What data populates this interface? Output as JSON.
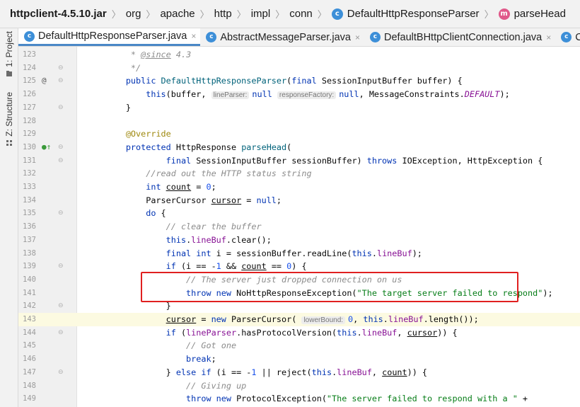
{
  "breadcrumb": {
    "items": [
      {
        "label": "httpclient-4.5.10.jar",
        "icon": "",
        "bold": true
      },
      {
        "label": "org",
        "icon": ""
      },
      {
        "label": "apache",
        "icon": ""
      },
      {
        "label": "http",
        "icon": ""
      },
      {
        "label": "impl",
        "icon": ""
      },
      {
        "label": "conn",
        "icon": ""
      },
      {
        "label": "DefaultHttpResponseParser",
        "icon": "class"
      },
      {
        "label": "parseHead",
        "icon": "method"
      }
    ],
    "class_glyph": "c",
    "method_glyph": "m"
  },
  "toolstrip": {
    "project_label": "1: Project",
    "structure_label": "Z: Structure"
  },
  "tabs": [
    {
      "label": "DefaultHttpResponseParser.java",
      "active": true,
      "close": "×"
    },
    {
      "label": "AbstractMessageParser.java",
      "active": false,
      "close": "×"
    },
    {
      "label": "DefaultBHttpClientConnection.java",
      "active": false,
      "close": "×"
    },
    {
      "label": "CPo",
      "active": false,
      "close": ""
    }
  ],
  "editor": {
    "highlight_color": "#e02020",
    "lines": [
      {
        "num": "123",
        "fold": "",
        "gutter": "",
        "tokens": [
          [
            "cmt",
            "         * "
          ],
          [
            "cmt doctag",
            "@since"
          ],
          [
            "cmt",
            " 4.3"
          ]
        ]
      },
      {
        "num": "124",
        "fold": "⊖",
        "gutter": "",
        "tokens": [
          [
            "cmt",
            "         */"
          ]
        ]
      },
      {
        "num": "125",
        "fold": "⊖",
        "gutter": "@",
        "tokens": [
          [
            "",
            "        "
          ],
          [
            "kw",
            "public "
          ],
          [
            "fn",
            "DefaultHttpResponseParser"
          ],
          [
            "",
            "("
          ],
          [
            "kw",
            "final "
          ],
          [
            "",
            "SessionInputBuffer buffer) {"
          ]
        ]
      },
      {
        "num": "126",
        "fold": "",
        "gutter": "",
        "tokens": [
          [
            "",
            "            "
          ],
          [
            "kw",
            "this"
          ],
          [
            "",
            "(buffer, "
          ],
          [
            "hint",
            "lineParser:"
          ],
          [
            "kw",
            "null"
          ],
          [
            ",",
            " "
          ],
          [
            "hint",
            "responseFactory:"
          ],
          [
            "kw",
            "null"
          ],
          [
            "",
            ", MessageConstraints."
          ],
          [
            "ital",
            "DEFAULT"
          ],
          [
            "",
            ");"
          ]
        ]
      },
      {
        "num": "127",
        "fold": "⊖",
        "gutter": "",
        "tokens": [
          [
            "",
            "        }"
          ]
        ]
      },
      {
        "num": "128",
        "fold": "",
        "gutter": "",
        "tokens": [
          [
            "",
            ""
          ]
        ]
      },
      {
        "num": "129",
        "fold": "",
        "gutter": "",
        "tokens": [
          [
            "",
            "        "
          ],
          [
            "ann",
            "@Override"
          ]
        ]
      },
      {
        "num": "130",
        "fold": "⊖",
        "gutter": "●↑",
        "gutter_class": "ov",
        "tokens": [
          [
            "",
            "        "
          ],
          [
            "kw",
            "protected "
          ],
          [
            "",
            "HttpResponse "
          ],
          [
            "fn",
            "parseHead"
          ],
          [
            "",
            "("
          ]
        ]
      },
      {
        "num": "131",
        "fold": "⊖",
        "gutter": "",
        "tokens": [
          [
            "",
            "                "
          ],
          [
            "kw",
            "final "
          ],
          [
            "",
            "SessionInputBuffer sessionBuffer) "
          ],
          [
            "kw",
            "throws "
          ],
          [
            "",
            "IOException, HttpException {"
          ]
        ]
      },
      {
        "num": "132",
        "fold": "",
        "gutter": "",
        "tokens": [
          [
            "",
            "            "
          ],
          [
            "cmt",
            "//read out the HTTP status string"
          ]
        ]
      },
      {
        "num": "133",
        "fold": "",
        "gutter": "",
        "tokens": [
          [
            "",
            "            "
          ],
          [
            "kw",
            "int "
          ],
          [
            "u",
            "count"
          ],
          [
            "",
            " = "
          ],
          [
            "num",
            "0"
          ],
          [
            "",
            ";"
          ]
        ]
      },
      {
        "num": "134",
        "fold": "",
        "gutter": "",
        "tokens": [
          [
            "",
            "            ParserCursor "
          ],
          [
            "u",
            "cursor"
          ],
          [
            "",
            " = "
          ],
          [
            "kw",
            "null"
          ],
          [
            "",
            ";"
          ]
        ]
      },
      {
        "num": "135",
        "fold": "⊖",
        "gutter": "",
        "tokens": [
          [
            "",
            "            "
          ],
          [
            "kw",
            "do "
          ],
          [
            "",
            "{"
          ]
        ]
      },
      {
        "num": "136",
        "fold": "",
        "gutter": "",
        "tokens": [
          [
            "",
            "                "
          ],
          [
            "cmt",
            "// clear the buffer"
          ]
        ]
      },
      {
        "num": "137",
        "fold": "",
        "gutter": "",
        "tokens": [
          [
            "",
            "                "
          ],
          [
            "kw",
            "this"
          ],
          [
            "",
            "."
          ],
          [
            "fld",
            "lineBuf"
          ],
          [
            "",
            ".clear();"
          ]
        ]
      },
      {
        "num": "138",
        "fold": "",
        "gutter": "",
        "tokens": [
          [
            "",
            "                "
          ],
          [
            "kw",
            "final int "
          ],
          [
            "",
            "i = sessionBuffer.readLine("
          ],
          [
            "kw",
            "this"
          ],
          [
            "",
            "."
          ],
          [
            "fld",
            "lineBuf"
          ],
          [
            "",
            ");"
          ]
        ]
      },
      {
        "num": "139",
        "fold": "⊖",
        "gutter": "",
        "tokens": [
          [
            "",
            "                "
          ],
          [
            "kw",
            "if "
          ],
          [
            "",
            "(i == -"
          ],
          [
            "num",
            "1"
          ],
          [
            "",
            " && "
          ],
          [
            "u",
            "count"
          ],
          [
            "",
            " == "
          ],
          [
            "num",
            "0"
          ],
          [
            "",
            ") {"
          ]
        ]
      },
      {
        "num": "140",
        "fold": "",
        "gutter": "",
        "tokens": [
          [
            "",
            "                    "
          ],
          [
            "cmt",
            "// The server just dropped connection on us"
          ]
        ]
      },
      {
        "num": "141",
        "fold": "",
        "gutter": "",
        "tokens": [
          [
            "",
            "                    "
          ],
          [
            "kw",
            "throw new "
          ],
          [
            "",
            "NoHttpResponseException("
          ],
          [
            "str",
            "\"The target server failed to respond\""
          ],
          [
            "",
            ");"
          ]
        ]
      },
      {
        "num": "142",
        "fold": "⊖",
        "gutter": "",
        "tokens": [
          [
            "",
            "                }"
          ]
        ]
      },
      {
        "num": "143",
        "fold": "",
        "gutter": "",
        "current": true,
        "tokens": [
          [
            "",
            "                "
          ],
          [
            "u",
            "cursor"
          ],
          [
            "",
            " = "
          ],
          [
            "kw",
            "new "
          ],
          [
            "",
            "ParserCursor( "
          ],
          [
            "hint",
            "lowerBound:"
          ],
          [
            "num",
            "0"
          ],
          [
            "",
            ", "
          ],
          [
            "kw",
            "this"
          ],
          [
            "",
            "."
          ],
          [
            "fld",
            "lineBuf"
          ],
          [
            "",
            ".length());"
          ]
        ]
      },
      {
        "num": "144",
        "fold": "⊖",
        "gutter": "",
        "tokens": [
          [
            "",
            "                "
          ],
          [
            "kw",
            "if "
          ],
          [
            "",
            "("
          ],
          [
            "fld",
            "lineParser"
          ],
          [
            "",
            ".hasProtocolVersion("
          ],
          [
            "kw",
            "this"
          ],
          [
            "",
            "."
          ],
          [
            "fld",
            "lineBuf"
          ],
          [
            "",
            ", "
          ],
          [
            "u",
            "cursor"
          ],
          [
            "",
            ")) {"
          ]
        ]
      },
      {
        "num": "145",
        "fold": "",
        "gutter": "",
        "tokens": [
          [
            "",
            "                    "
          ],
          [
            "cmt",
            "// Got one"
          ]
        ]
      },
      {
        "num": "146",
        "fold": "",
        "gutter": "",
        "tokens": [
          [
            "",
            "                    "
          ],
          [
            "kw",
            "break"
          ],
          [
            "",
            ";"
          ]
        ]
      },
      {
        "num": "147",
        "fold": "⊖",
        "gutter": "",
        "tokens": [
          [
            "",
            "                } "
          ],
          [
            "kw",
            "else if "
          ],
          [
            "",
            "(i == -"
          ],
          [
            "num",
            "1"
          ],
          [
            "",
            " || reject("
          ],
          [
            "kw",
            "this"
          ],
          [
            "",
            "."
          ],
          [
            "fld",
            "lineBuf"
          ],
          [
            "",
            ", "
          ],
          [
            "u",
            "count"
          ],
          [
            "",
            ")) {"
          ]
        ]
      },
      {
        "num": "148",
        "fold": "",
        "gutter": "",
        "tokens": [
          [
            "",
            "                    "
          ],
          [
            "cmt",
            "// Giving up"
          ]
        ]
      },
      {
        "num": "149",
        "fold": "",
        "gutter": "",
        "tokens": [
          [
            "",
            "                    "
          ],
          [
            "kw",
            "throw new "
          ],
          [
            "",
            "ProtocolException("
          ],
          [
            "str",
            "\"The server failed to respond with a \""
          ],
          [
            "",
            " +"
          ]
        ]
      }
    ]
  }
}
